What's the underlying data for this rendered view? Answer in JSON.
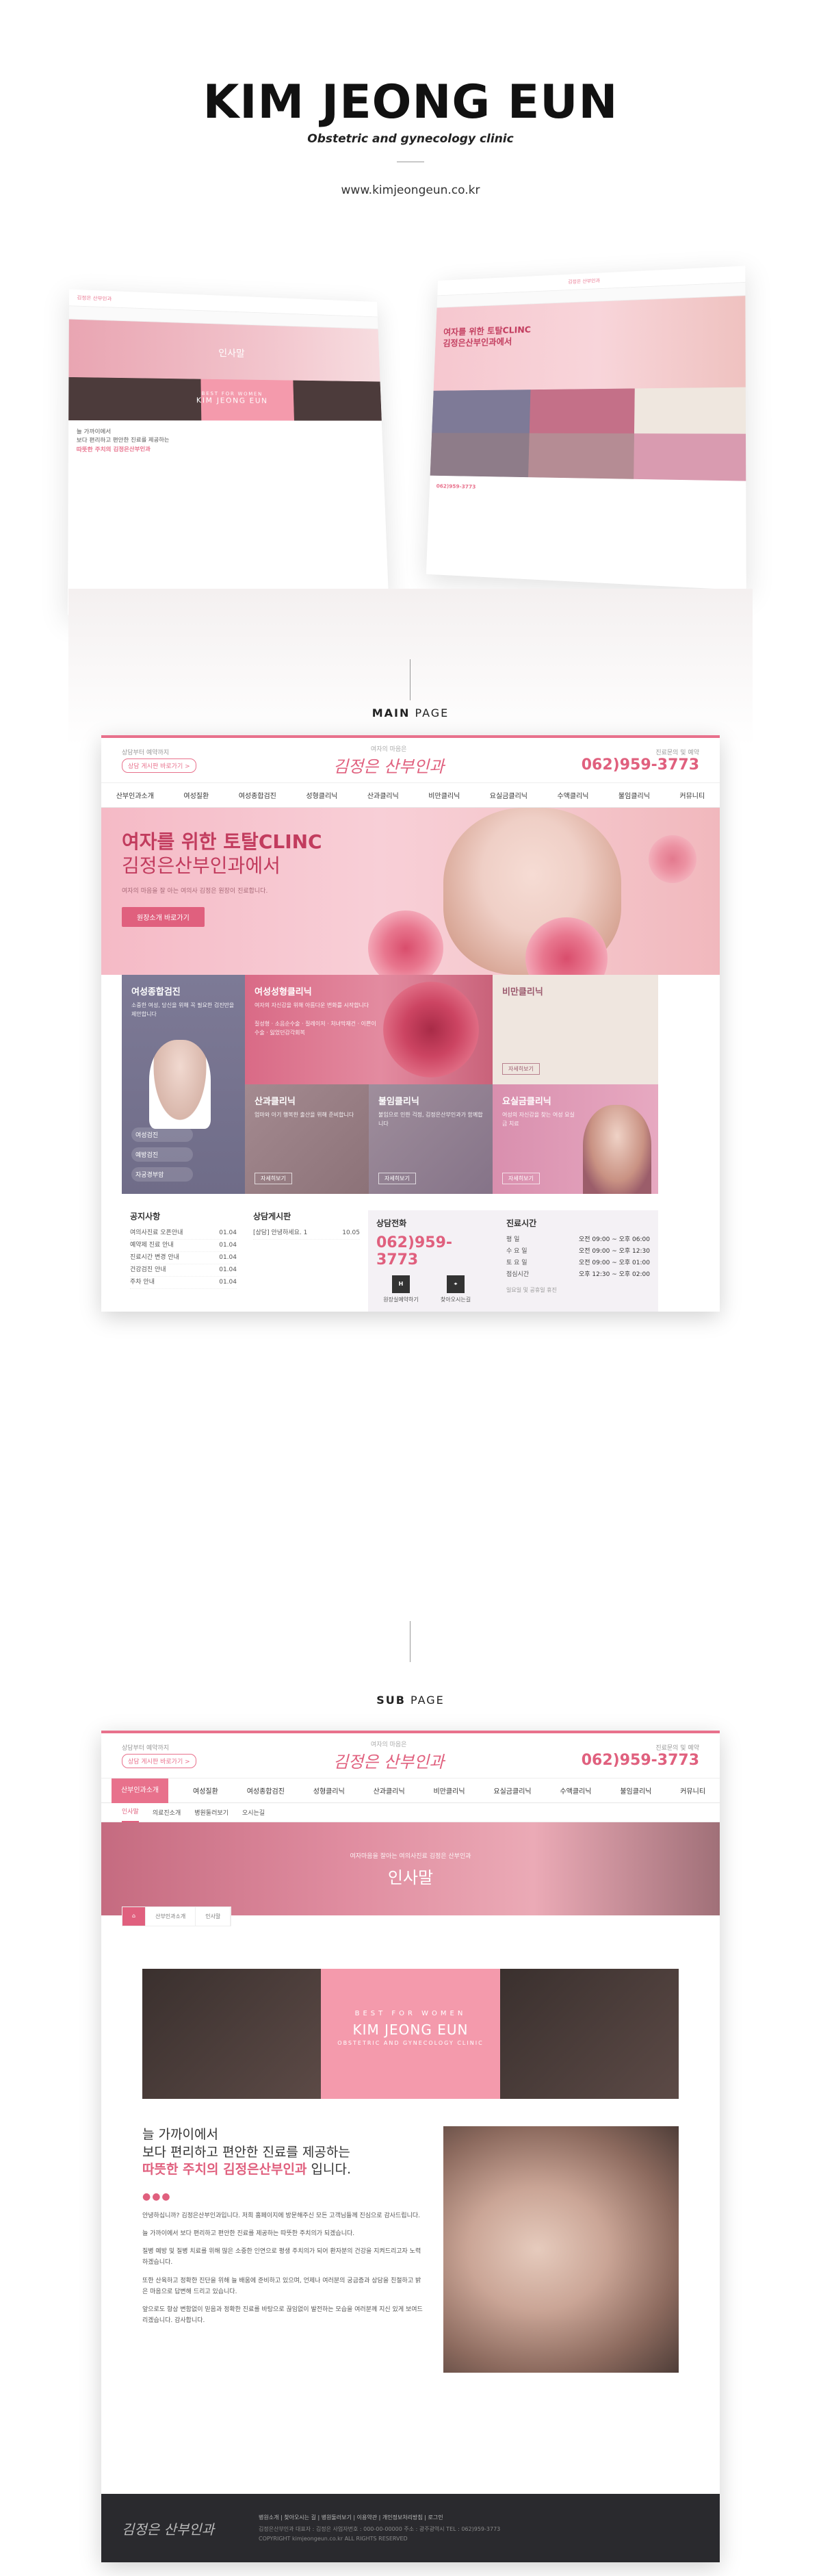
{
  "brand": {
    "title": "KIM JEONG EUN",
    "subtitle": "Obstetric and gynecology clinic",
    "url": "www.kimjeongeun.co.kr"
  },
  "sections": {
    "main_label_bold": "MAIN",
    "main_label": " PAGE",
    "sub_label_bold": "SUB",
    "sub_label": " PAGE"
  },
  "header": {
    "top_small": "상담부터 예약까지",
    "cta": "상담 게시판 바로가기 >",
    "logo_small": "여자의 마음은",
    "logo": "김정은 산부인과",
    "phone_label": "진료문의 및 예약",
    "phone": "062)959-3773"
  },
  "nav": [
    "산부인과소개",
    "여성질환",
    "여성종합검진",
    "성형클리닉",
    "산과클리닉",
    "비만클리닉",
    "요실금클리닉",
    "수액클리닉",
    "불임클리닉",
    "커뮤니티"
  ],
  "hero": {
    "line1": "여자를 위한 토탈CLINC",
    "line2": "김정은산부인과에서",
    "small": "여자의 마음을 잘 아는 여의사 김정은 원장이 진료합니다.",
    "button": "원장소개 바로가기"
  },
  "cards": {
    "c1": {
      "title": "여성종합검진",
      "desc": "소중한 여성, 당신을 위해 꼭 필요한 검진만을 제안합니다",
      "chips": [
        "여성검진",
        "예방검진",
        "자궁경부암"
      ]
    },
    "c2": {
      "title": "여성성형클리닉",
      "desc": "여자의 자신감을 위해 아름다운 변화를 시작합니다",
      "list": "질성형 · 소음순수술 · 질레이저 · 처녀막재건 · 이쁜이수술 · 잃었던감각회복"
    },
    "c3": {
      "title": "비만클리닉",
      "desc": "",
      "more": "자세히보기"
    },
    "c4a": {
      "title": "산과클리닉",
      "desc": "엄마와 아기 행복한 출산을 위해 준비합니다",
      "more": "자세히보기"
    },
    "c4b": {
      "title": "불임클리닉",
      "desc": "불임으로 인한 걱정, 김정은산부인과가 함께합니다",
      "more": "자세히보기"
    },
    "c5": {
      "title": "요실금클리닉",
      "desc": "여성의 자신감을 찾는 여성 요실금 치료",
      "more": "자세히보기"
    }
  },
  "notice": {
    "title": "공지사항",
    "items": [
      {
        "t": "여의사진료 오픈안내",
        "d": "01.04"
      },
      {
        "t": "예약제 진료 안내",
        "d": "01.04"
      },
      {
        "t": "진료시간 변경 안내",
        "d": "01.04"
      },
      {
        "t": "건강검진 안내",
        "d": "01.04"
      },
      {
        "t": "주차 안내",
        "d": "01.04"
      }
    ]
  },
  "qna": {
    "title": "상담게시판",
    "items": [
      {
        "t": "[상담] 안녕하세요. 1",
        "d": "10.05"
      }
    ]
  },
  "consult": {
    "title": "상담전화",
    "phone": "062)959-3773",
    "btn1": "원장실예약하기",
    "btn2": "찾아오시는길",
    "btn1_icon": "H",
    "btn2_icon": "⌖"
  },
  "hours": {
    "title": "진료시간",
    "rows": [
      {
        "day": "평 일",
        "time": "오전 09:00 ~ 오후 06:00"
      },
      {
        "day": "수 요 일",
        "time": "오전 09:00 ~ 오후 12:30"
      },
      {
        "day": "토 요 일",
        "time": "오전 09:00 ~ 오후 01:00"
      },
      {
        "day": "점심시간",
        "time": "오후 12:30 ~ 오후 02:00"
      }
    ],
    "note": "일요일 및 공휴일 휴진"
  },
  "footer": {
    "logo": "김정은 산부인과",
    "links": "병원소개  |  찾아오시는 길  |  병원둘러보기  |  이용약관  |  개인정보처리방침  |  로그인",
    "addr": "김정은산부인과 대표자 : 김정은 사업자번호 : 000-00-00000 주소 : 광주광역시 TEL : 062)959-3773",
    "copy": "COPYRIGHT kimjeongeun.co.kr ALL RIGHTS RESERVED",
    "top": "↑"
  },
  "sub": {
    "tabs": [
      "인사말",
      "의료진소개",
      "병원둘러보기",
      "오시는길"
    ],
    "hero_small": "여자마음을 잘아는 여의사진료 김정은 산부인과",
    "hero_title": "인사말",
    "crumb_home": "⌂",
    "crumb1": "산부인과소개",
    "crumb2": "인사말",
    "band_line1": "BEST FOR WOMEN",
    "band_line2": "KIM JEONG EUN",
    "band_line3": "OBSTETRIC AND GYNECOLOGY CLINIC",
    "greet_l1": "늘 가까이에서",
    "greet_l2": "보다 편리하고 편안한 진료를 제공하는",
    "greet_l3_b": "따뜻한 주치의 김정은산부인과",
    "greet_l3": " 입니다.",
    "dots": "●●●",
    "p1": "안녕하십니까? 김정은산부인과입니다. 저희 홈페이지에 방문해주신 모든 고객님들께 진심으로 감사드립니다.",
    "p2": "늘 가까이에서 보다 편리하고 편안한 진료를 제공하는 따뜻한 주치의가 되겠습니다.",
    "p3": "질병 예방 및 질병 치료를 위해 많은 소중한 인연으로 평생 주치의가 되어 환자분의 건강을 지켜드리고자 노력하겠습니다.",
    "p4": "또한 산육하고 정확한 진단을 위해 늘 배움에 준비하고 있으며, 언제나 여러분의 궁금증과 상담을 친절하고 밝은 마음으로 답변해 드리고 있습니다.",
    "p5": "앞으로도 항상 변함없이 믿음과 정확한 진료를 바탕으로 끊임없이 발전하는 모습을 여러분께 지신 있게 보여드리겠습니다. 감사합니다."
  },
  "mock": {
    "left_hero": "인사말",
    "left_band": "BEST FOR WOMEN",
    "left_band2": "KIM JEONG EUN",
    "right_hero1": "여자를 위한 토탈CLINC",
    "right_hero2": "김정은산부인과에서"
  }
}
